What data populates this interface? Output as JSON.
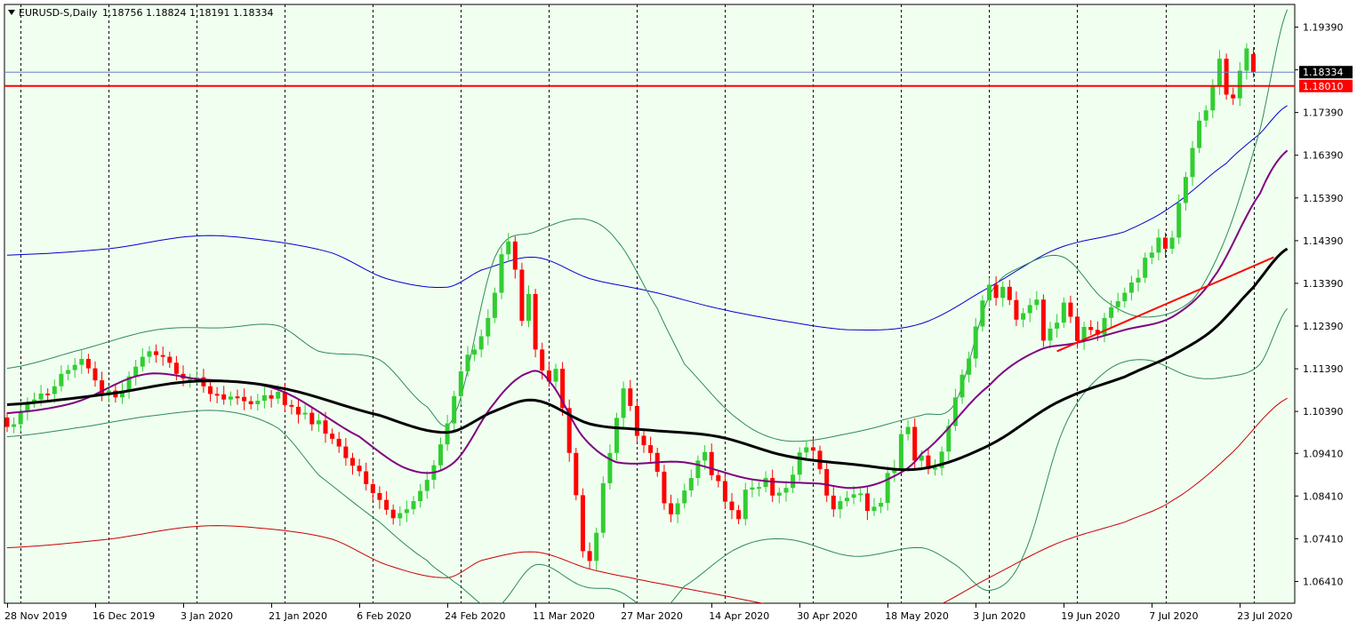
{
  "header": {
    "symbol": "EURUSD-S,Daily",
    "ohlc": "1.18756 1.18824 1.18191 1.18334"
  },
  "colors": {
    "background": "#f0fff0",
    "bull": "#32cd32",
    "bear": "#ff0000",
    "grid": "#000000",
    "ma_fast": "#800080",
    "ma_slow": "#000000",
    "envelope_upper": "#0000cd",
    "envelope_lower": "#cc0000",
    "bollinger": "#2e8b57",
    "level": "#ff0000",
    "current_price_bg": "#000000",
    "level_tag_bg": "#ff0000"
  },
  "chart_data": {
    "type": "candlestick",
    "y_ticks": [
      "1.19390",
      "1.18390",
      "1.17390",
      "1.16390",
      "1.15390",
      "1.14390",
      "1.13390",
      "1.12390",
      "1.11390",
      "1.10390",
      "1.09410",
      "1.08410",
      "1.07410",
      "1.06410"
    ],
    "y_tick_values": [
      1.1939,
      1.1839,
      1.1739,
      1.1639,
      1.1539,
      1.1439,
      1.1339,
      1.1239,
      1.1139,
      1.1039,
      1.0941,
      1.0841,
      1.0741,
      1.0641
    ],
    "ylim": [
      1.059,
      1.1992
    ],
    "x_labels": [
      "28 Nov 2019",
      "16 Dec 2019",
      "3 Jan 2020",
      "21 Jan 2020",
      "6 Feb 2020",
      "24 Feb 2020",
      "11 Mar 2020",
      "27 Mar 2020",
      "14 Apr 2020",
      "30 Apr 2020",
      "18 May 2020",
      "3 Jun 2020",
      "19 Jun 2020",
      "7 Jul 2020",
      "23 Jul 2020"
    ],
    "x_label_bars": [
      0,
      13,
      26,
      39,
      52,
      65,
      78,
      91,
      104,
      117,
      130,
      143,
      156,
      169,
      182
    ],
    "separator_bars": [
      2,
      15,
      28,
      41,
      54,
      67,
      80,
      93,
      106,
      119,
      132,
      145,
      158,
      171,
      184
    ],
    "bar_count": 189,
    "current_price": {
      "value": 1.18334,
      "label": "1.18334"
    },
    "level_line": {
      "value": 1.1801,
      "label": "1.18010"
    },
    "trendline": {
      "from": {
        "bar": 155,
        "price": 1.118
      },
      "to": {
        "bar": 187,
        "price": 1.14
      }
    },
    "ma_fast_anchors": [
      [
        0,
        1.1035
      ],
      [
        10,
        1.106
      ],
      [
        20,
        1.1125
      ],
      [
        28,
        1.1115
      ],
      [
        40,
        1.109
      ],
      [
        52,
        1.098
      ],
      [
        60,
        1.09
      ],
      [
        66,
        1.092
      ],
      [
        72,
        1.106
      ],
      [
        77,
        1.113
      ],
      [
        80,
        1.111
      ],
      [
        85,
        1.098
      ],
      [
        90,
        1.092
      ],
      [
        100,
        1.092
      ],
      [
        110,
        1.088
      ],
      [
        120,
        1.087
      ],
      [
        125,
        1.086
      ],
      [
        130,
        1.088
      ],
      [
        135,
        1.094
      ],
      [
        145,
        1.11
      ],
      [
        152,
        1.118
      ],
      [
        158,
        1.12
      ],
      [
        165,
        1.123
      ],
      [
        172,
        1.126
      ],
      [
        178,
        1.135
      ],
      [
        185,
        1.155
      ],
      [
        189,
        1.165
      ]
    ],
    "ma_slow_anchors": [
      [
        0,
        1.1055
      ],
      [
        15,
        1.108
      ],
      [
        28,
        1.111
      ],
      [
        40,
        1.1095
      ],
      [
        55,
        1.103
      ],
      [
        65,
        1.099
      ],
      [
        72,
        1.104
      ],
      [
        78,
        1.1065
      ],
      [
        86,
        1.101
      ],
      [
        95,
        1.0995
      ],
      [
        105,
        1.098
      ],
      [
        115,
        1.0935
      ],
      [
        125,
        1.0915
      ],
      [
        135,
        1.0905
      ],
      [
        145,
        1.096
      ],
      [
        155,
        1.106
      ],
      [
        165,
        1.112
      ],
      [
        172,
        1.117
      ],
      [
        178,
        1.123
      ],
      [
        184,
        1.133
      ],
      [
        189,
        1.142
      ]
    ],
    "env_upper_anchors": [
      [
        0,
        1.1405
      ],
      [
        15,
        1.142
      ],
      [
        28,
        1.145
      ],
      [
        38,
        1.144
      ],
      [
        48,
        1.141
      ],
      [
        56,
        1.135
      ],
      [
        65,
        1.133
      ],
      [
        70,
        1.137
      ],
      [
        78,
        1.14
      ],
      [
        86,
        1.135
      ],
      [
        95,
        1.132
      ],
      [
        105,
        1.128
      ],
      [
        115,
        1.125
      ],
      [
        125,
        1.123
      ],
      [
        135,
        1.1245
      ],
      [
        145,
        1.133
      ],
      [
        155,
        1.142
      ],
      [
        165,
        1.146
      ],
      [
        172,
        1.152
      ],
      [
        180,
        1.162
      ],
      [
        185,
        1.169
      ],
      [
        189,
        1.1755
      ]
    ],
    "env_lower_anchors": [
      [
        0,
        1.072
      ],
      [
        15,
        1.074
      ],
      [
        28,
        1.077
      ],
      [
        38,
        1.0765
      ],
      [
        48,
        1.074
      ],
      [
        56,
        1.068
      ],
      [
        65,
        1.065
      ],
      [
        70,
        1.069
      ],
      [
        78,
        1.071
      ],
      [
        86,
        1.067
      ],
      [
        95,
        1.064
      ],
      [
        105,
        1.061
      ],
      [
        115,
        1.058
      ],
      [
        125,
        1.056
      ],
      [
        135,
        1.057
      ],
      [
        145,
        1.065
      ],
      [
        155,
        1.073
      ],
      [
        165,
        1.078
      ],
      [
        172,
        1.083
      ],
      [
        180,
        1.093
      ],
      [
        189,
        1.107
      ]
    ],
    "bb_upper_anchors": [
      [
        0,
        1.114
      ],
      [
        10,
        1.118
      ],
      [
        22,
        1.123
      ],
      [
        32,
        1.1235
      ],
      [
        40,
        1.124
      ],
      [
        46,
        1.118
      ],
      [
        55,
        1.116
      ],
      [
        62,
        1.105
      ],
      [
        66,
        1.103
      ],
      [
        72,
        1.14
      ],
      [
        78,
        1.146
      ],
      [
        85,
        1.149
      ],
      [
        90,
        1.144
      ],
      [
        96,
        1.128
      ],
      [
        100,
        1.115
      ],
      [
        108,
        1.102
      ],
      [
        115,
        1.097
      ],
      [
        125,
        1.099
      ],
      [
        135,
        1.103
      ],
      [
        140,
        1.106
      ],
      [
        145,
        1.131
      ],
      [
        150,
        1.138
      ],
      [
        156,
        1.14
      ],
      [
        162,
        1.13
      ],
      [
        168,
        1.126
      ],
      [
        175,
        1.13
      ],
      [
        180,
        1.145
      ],
      [
        185,
        1.17
      ],
      [
        189,
        1.198
      ]
    ],
    "bb_lower_anchors": [
      [
        0,
        1.098
      ],
      [
        10,
        1.1
      ],
      [
        22,
        1.103
      ],
      [
        32,
        1.104
      ],
      [
        40,
        1.1
      ],
      [
        46,
        1.089
      ],
      [
        55,
        1.078
      ],
      [
        62,
        1.069
      ],
      [
        66,
        1.064
      ],
      [
        72,
        1.058
      ],
      [
        78,
        1.068
      ],
      [
        85,
        1.063
      ],
      [
        90,
        1.062
      ],
      [
        96,
        1.057
      ],
      [
        100,
        1.063
      ],
      [
        108,
        1.072
      ],
      [
        115,
        1.074
      ],
      [
        125,
        1.07
      ],
      [
        135,
        1.072
      ],
      [
        140,
        1.068
      ],
      [
        145,
        1.062
      ],
      [
        150,
        1.07
      ],
      [
        156,
        1.1
      ],
      [
        162,
        1.113
      ],
      [
        168,
        1.116
      ],
      [
        175,
        1.112
      ],
      [
        180,
        1.112
      ],
      [
        185,
        1.115
      ],
      [
        189,
        1.128
      ]
    ],
    "candle_closes": [
      1.1003,
      1.1009,
      1.1039,
      1.106,
      1.1067,
      1.1081,
      1.108,
      1.1098,
      1.1127,
      1.1136,
      1.1148,
      1.1162,
      1.114,
      1.1112,
      1.1081,
      1.1088,
      1.1072,
      1.1087,
      1.1121,
      1.1144,
      1.1167,
      1.118,
      1.1171,
      1.1167,
      1.1153,
      1.1127,
      1.1116,
      1.1116,
      1.1119,
      1.1098,
      1.108,
      1.1079,
      1.1067,
      1.1074,
      1.1073,
      1.1063,
      1.1056,
      1.1064,
      1.1077,
      1.1069,
      1.1085,
      1.1054,
      1.105,
      1.1032,
      1.1036,
      1.1009,
      1.1018,
      1.0987,
      1.0975,
      1.0957,
      1.093,
      1.0912,
      1.0899,
      1.0869,
      1.0848,
      1.0832,
      1.0809,
      1.0789,
      1.0801,
      1.081,
      1.0829,
      1.0853,
      1.0879,
      1.0913,
      1.0962,
      1.1011,
      1.1075,
      1.1133,
      1.1172,
      1.1184,
      1.1215,
      1.1258,
      1.1317,
      1.1407,
      1.1437,
      1.1371,
      1.1251,
      1.1314,
      1.1184,
      1.1135,
      1.1109,
      1.1139,
      1.1047,
      1.0942,
      1.0843,
      1.0712,
      1.0689,
      1.0755,
      1.0871,
      1.0942,
      1.1024,
      1.1093,
      1.1052,
      1.0982,
      1.096,
      1.0942,
      1.0898,
      1.0824,
      1.0798,
      1.0824,
      1.0854,
      1.0883,
      1.0924,
      1.0944,
      1.089,
      1.0876,
      1.0828,
      1.0808,
      1.0787,
      1.0856,
      1.0861,
      1.0862,
      1.0883,
      1.0842,
      1.0849,
      1.086,
      1.0891,
      1.0943,
      1.0955,
      1.0947,
      1.0904,
      1.0842,
      1.081,
      1.0829,
      1.0837,
      1.0845,
      1.0847,
      1.0806,
      1.0816,
      1.0825,
      1.0895,
      1.0906,
      1.0986,
      1.1003,
      1.0924,
      1.0936,
      1.0904,
      1.0907,
      1.0945,
      1.1005,
      1.1072,
      1.1125,
      1.1163,
      1.1238,
      1.1299,
      1.1336,
      1.1305,
      1.1331,
      1.13,
      1.1254,
      1.1269,
      1.1288,
      1.1301,
      1.1205,
      1.1233,
      1.1247,
      1.1294,
      1.1261,
      1.1204,
      1.1237,
      1.123,
      1.1219,
      1.1258,
      1.1283,
      1.1297,
      1.1317,
      1.1341,
      1.1352,
      1.1399,
      1.1411,
      1.1446,
      1.142,
      1.1446,
      1.1527,
      1.1588,
      1.1656,
      1.172,
      1.1744,
      1.1801,
      1.1865,
      1.1781,
      1.1772,
      1.1837,
      1.1889,
      1.1833
    ],
    "candle_opens": [
      1.1025,
      1.1003,
      1.1009,
      1.1039,
      1.106,
      1.1067,
      1.1081,
      1.108,
      1.1098,
      1.1127,
      1.1136,
      1.1148,
      1.1162,
      1.114,
      1.1112,
      1.1081,
      1.1088,
      1.1072,
      1.1087,
      1.1121,
      1.1144,
      1.1167,
      1.118,
      1.1171,
      1.1167,
      1.1153,
      1.1127,
      1.1116,
      1.1116,
      1.1119,
      1.1098,
      1.108,
      1.1079,
      1.1067,
      1.1074,
      1.1073,
      1.1063,
      1.1056,
      1.1064,
      1.1077,
      1.1069,
      1.1085,
      1.1054,
      1.105,
      1.1032,
      1.1036,
      1.1009,
      1.1018,
      1.0987,
      1.0975,
      1.0957,
      1.093,
      1.0912,
      1.0899,
      1.0869,
      1.0848,
      1.0832,
      1.0809,
      1.0789,
      1.0801,
      1.081,
      1.0829,
      1.0853,
      1.0879,
      1.0913,
      1.0962,
      1.1011,
      1.1075,
      1.1133,
      1.1172,
      1.1184,
      1.1215,
      1.1258,
      1.1317,
      1.1407,
      1.1437,
      1.1371,
      1.1251,
      1.1314,
      1.1184,
      1.1135,
      1.1109,
      1.1139,
      1.1047,
      1.0942,
      1.0843,
      1.0712,
      1.0689,
      1.0755,
      1.0871,
      1.0942,
      1.1024,
      1.1093,
      1.1052,
      1.0982,
      1.096,
      1.0942,
      1.0898,
      1.0824,
      1.0798,
      1.0824,
      1.0854,
      1.0883,
      1.0924,
      1.0944,
      1.089,
      1.0876,
      1.0828,
      1.0808,
      1.0787,
      1.0856,
      1.0861,
      1.0862,
      1.0883,
      1.0842,
      1.0849,
      1.086,
      1.0891,
      1.0943,
      1.0955,
      1.0947,
      1.0904,
      1.0842,
      1.081,
      1.0829,
      1.0837,
      1.0845,
      1.0847,
      1.0806,
      1.0816,
      1.0825,
      1.0895,
      1.0906,
      1.0986,
      1.1003,
      1.0924,
      1.0936,
      1.0904,
      1.0907,
      1.0945,
      1.1005,
      1.1072,
      1.1125,
      1.1163,
      1.1238,
      1.1299,
      1.1336,
      1.1305,
      1.1331,
      1.13,
      1.1254,
      1.1269,
      1.1288,
      1.1301,
      1.1205,
      1.1233,
      1.1247,
      1.1294,
      1.1261,
      1.1204,
      1.1237,
      1.123,
      1.1219,
      1.1258,
      1.1283,
      1.1297,
      1.1317,
      1.1341,
      1.1352,
      1.1399,
      1.1411,
      1.1446,
      1.142,
      1.1446,
      1.1527,
      1.1588,
      1.1656,
      1.172,
      1.1744,
      1.1801,
      1.1865,
      1.1781,
      1.1772,
      1.1837,
      1.1876
    ]
  }
}
